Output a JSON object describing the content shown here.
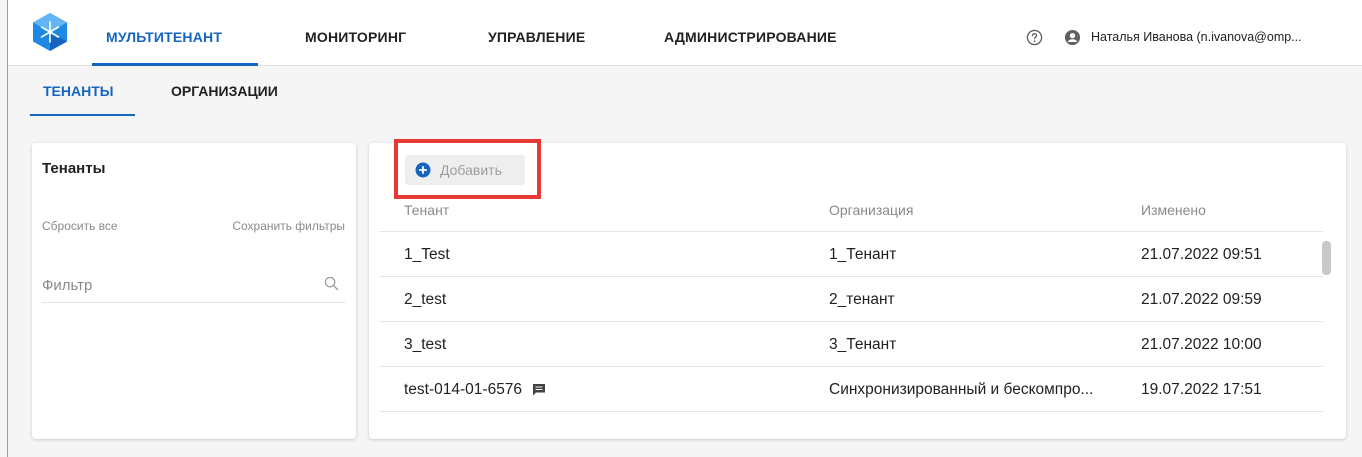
{
  "nav": {
    "items": [
      {
        "label": "МУЛЬТИТЕНАНТ"
      },
      {
        "label": "МОНИТОРИНГ"
      },
      {
        "label": "УПРАВЛЕНИЕ"
      },
      {
        "label": "АДМИНИСТРИРОВАНИЕ"
      }
    ],
    "active_index": 0,
    "user_name": "Наталья Иванова (n.ivanova@omp...",
    "icons": {
      "help": "help-circle-icon",
      "user": "user-avatar-icon",
      "logo": "app-logo-icon"
    }
  },
  "subtabs": {
    "items": [
      {
        "label": "ТЕНАНТЫ"
      },
      {
        "label": "ОРГАНИЗАЦИИ"
      }
    ],
    "active_index": 0
  },
  "filters": {
    "title": "Тенанты",
    "reset_label": "Сбросить все",
    "save_label": "Сохранить фильтры",
    "input_placeholder": "Фильтр",
    "input_value": ""
  },
  "table": {
    "add_label": "Добавить",
    "columns": [
      "Тенант",
      "Организация",
      "Изменено"
    ],
    "rows": [
      {
        "tenant": "1_Test",
        "org": "1_Тенант",
        "changed": "21.07.2022 09:51",
        "has_comment": false
      },
      {
        "tenant": "2_test",
        "org": "2_тенант",
        "changed": "21.07.2022 09:59",
        "has_comment": false
      },
      {
        "tenant": "3_test",
        "org": "3_Тенант",
        "changed": "21.07.2022 10:00",
        "has_comment": false
      },
      {
        "tenant": "test-014-01-6576",
        "org": "Синхронизированный и бескомпро...",
        "changed": "19.07.2022 17:51",
        "has_comment": true
      }
    ]
  },
  "colors": {
    "accent": "#1565c0",
    "highlight": "#e53935",
    "muted_text": "#8a8a8a"
  }
}
